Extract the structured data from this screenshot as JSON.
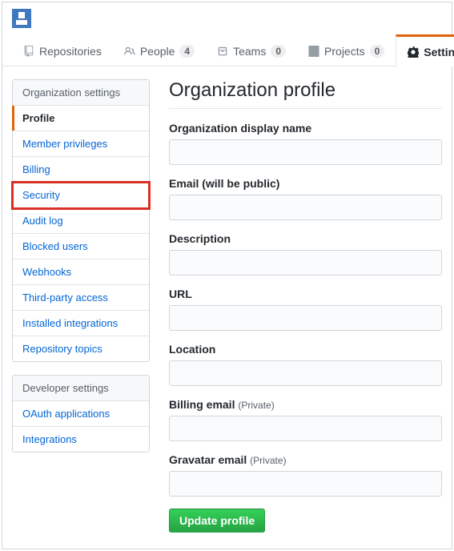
{
  "tabs": {
    "repositories": {
      "label": "Repositories"
    },
    "people": {
      "label": "People",
      "count": "4"
    },
    "teams": {
      "label": "Teams",
      "count": "0"
    },
    "projects": {
      "label": "Projects",
      "count": "0"
    },
    "settings": {
      "label": "Settings"
    }
  },
  "sidebar": {
    "org_header": "Organization settings",
    "org_items": [
      {
        "label": "Profile"
      },
      {
        "label": "Member privileges"
      },
      {
        "label": "Billing"
      },
      {
        "label": "Security"
      },
      {
        "label": "Audit log"
      },
      {
        "label": "Blocked users"
      },
      {
        "label": "Webhooks"
      },
      {
        "label": "Third-party access"
      },
      {
        "label": "Installed integrations"
      },
      {
        "label": "Repository topics"
      }
    ],
    "dev_header": "Developer settings",
    "dev_items": [
      {
        "label": "OAuth applications"
      },
      {
        "label": "Integrations"
      }
    ]
  },
  "main": {
    "title": "Organization profile",
    "fields": {
      "display_name": {
        "label": "Organization display name"
      },
      "email": {
        "label": "Email (will be public)"
      },
      "description": {
        "label": "Description"
      },
      "url": {
        "label": "URL"
      },
      "location": {
        "label": "Location"
      },
      "billing_email": {
        "label": "Billing email ",
        "note": "(Private)"
      },
      "gravatar_email": {
        "label": "Gravatar email ",
        "note": "(Private)"
      }
    },
    "submit": "Update profile"
  }
}
